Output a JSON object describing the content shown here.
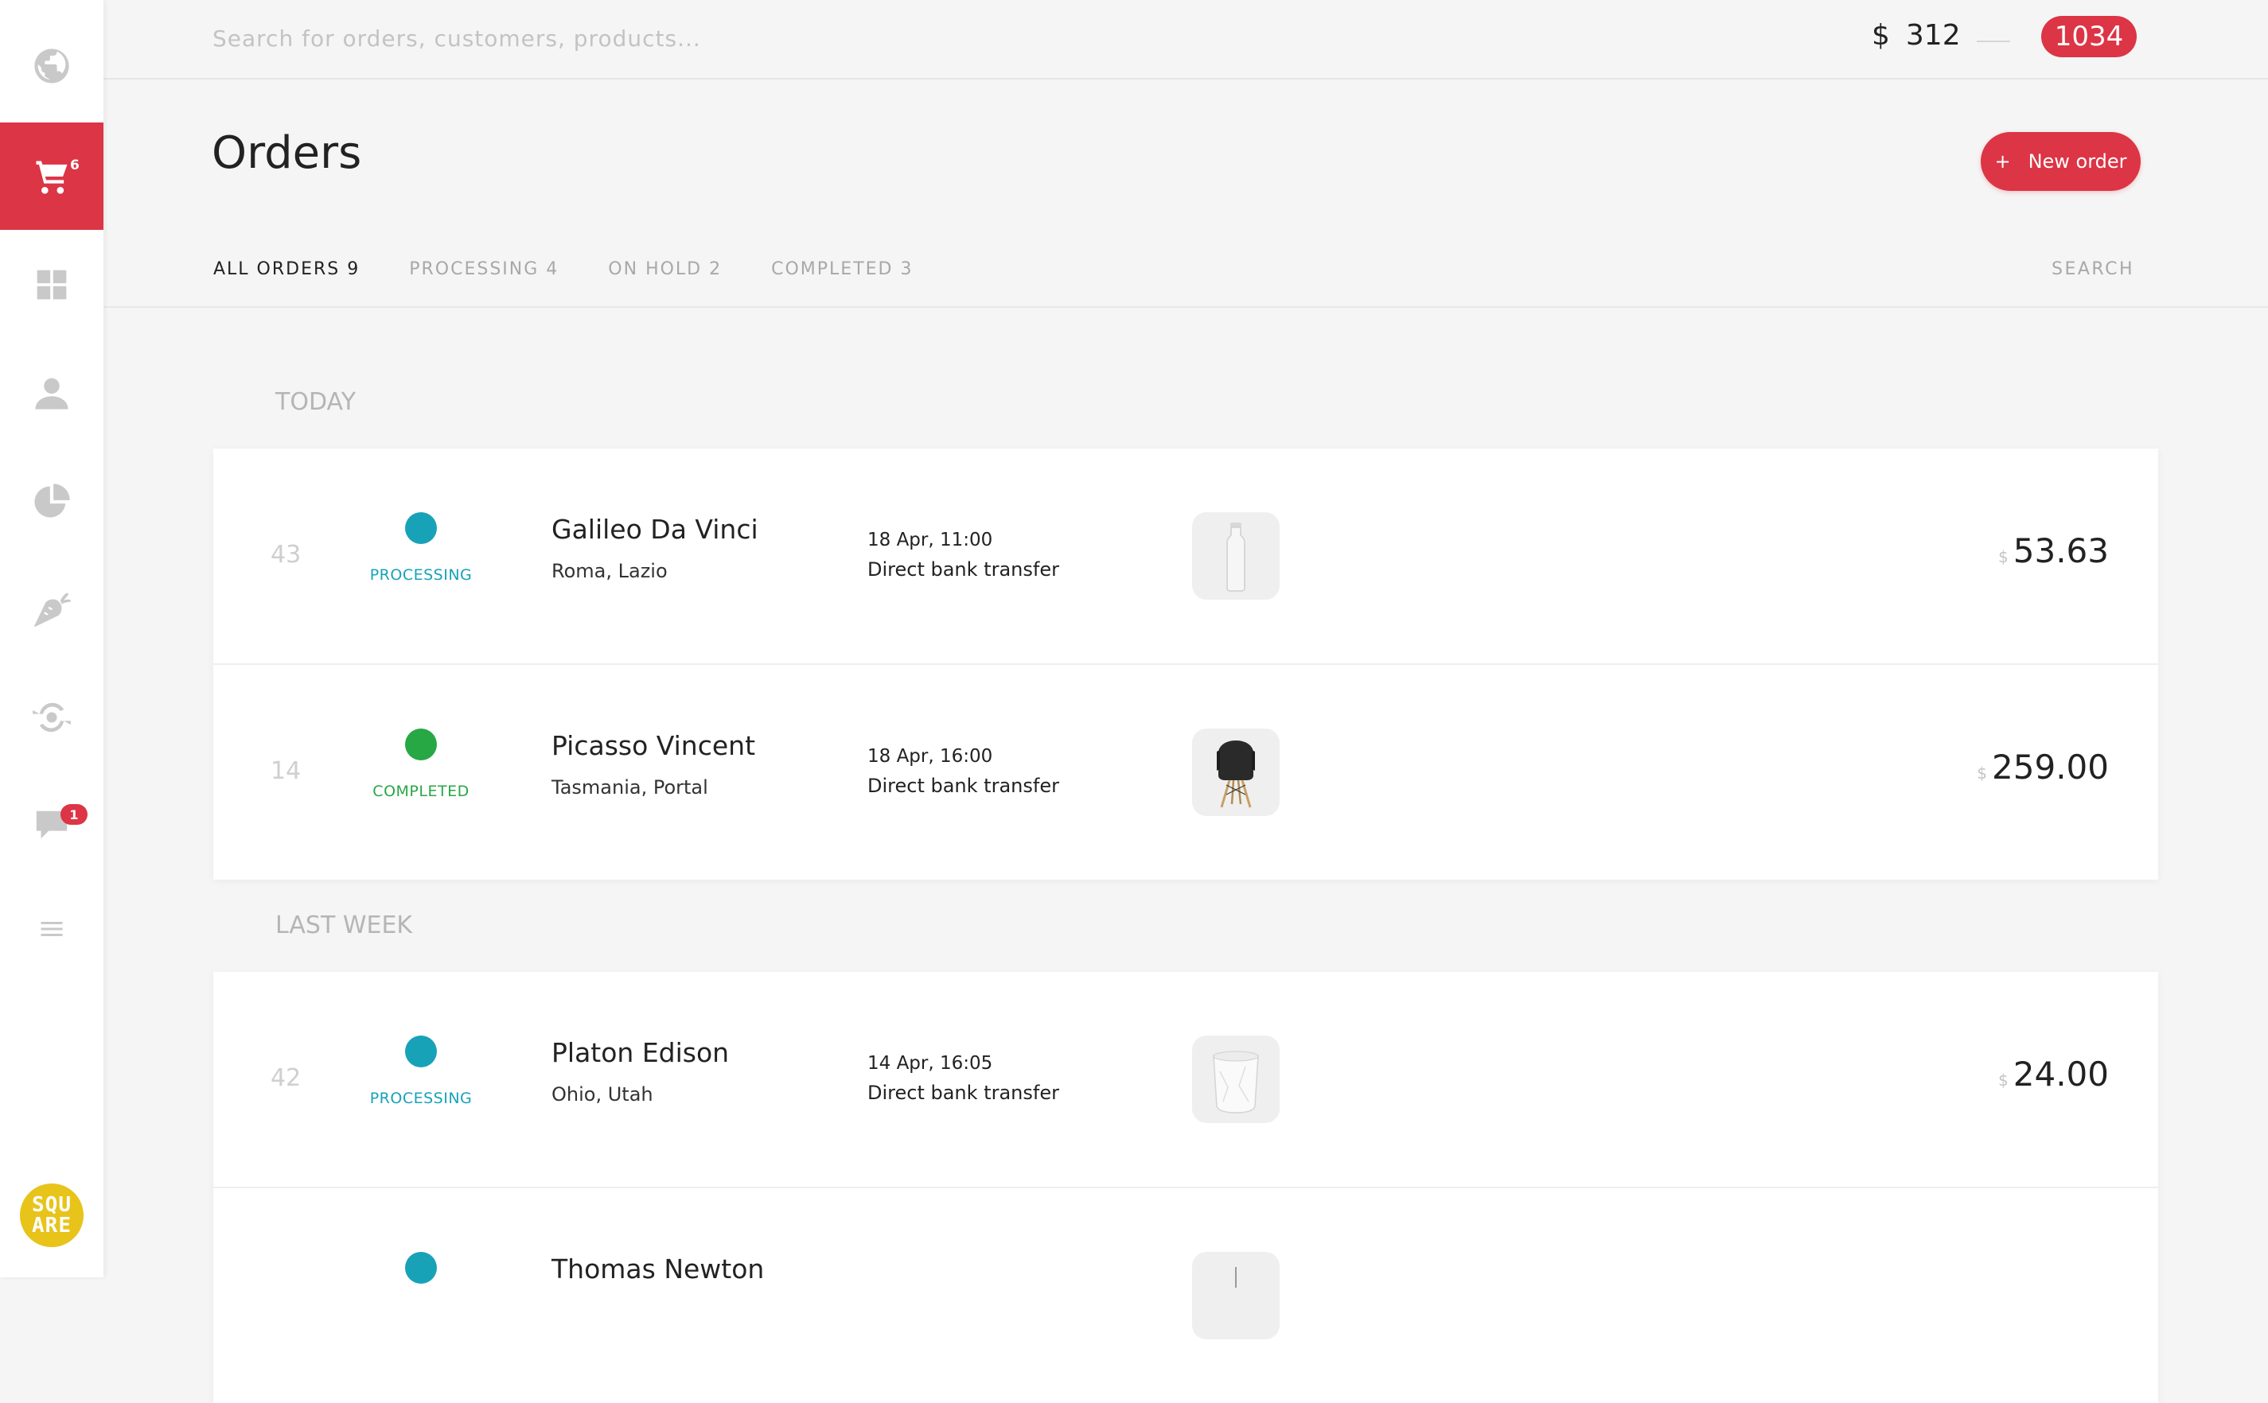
{
  "sidebar": {
    "items": [
      {
        "name": "globe",
        "icon": "globe-icon",
        "active": false
      },
      {
        "name": "orders",
        "icon": "cart-icon",
        "active": true,
        "badge": "6"
      },
      {
        "name": "dashboard",
        "icon": "grid-icon",
        "active": false
      },
      {
        "name": "customers",
        "icon": "user-icon",
        "active": false
      },
      {
        "name": "reports",
        "icon": "pie-chart-icon",
        "active": false
      },
      {
        "name": "products",
        "icon": "carrot-icon",
        "active": false
      },
      {
        "name": "view",
        "icon": "eye-sync-icon",
        "active": false
      },
      {
        "name": "messages",
        "icon": "chat-icon",
        "active": false,
        "badge": "1"
      },
      {
        "name": "menu",
        "icon": "menu-icon",
        "active": false
      }
    ],
    "logo": {
      "line1": "SQU",
      "line2": "ARE",
      "color": "#e8c31a"
    }
  },
  "header": {
    "search_placeholder": "Search for orders, customers, products...",
    "search_value": "",
    "balance_currency": "$",
    "balance_value": "312",
    "notification_count": "1034"
  },
  "page": {
    "title": "Orders",
    "new_order_icon": "+",
    "new_order_label": "New order"
  },
  "tabs": [
    {
      "label": "ALL ORDERS 9",
      "active": true
    },
    {
      "label": "PROCESSING 4",
      "active": false
    },
    {
      "label": "ON HOLD 2",
      "active": false
    },
    {
      "label": "COMPLETED 3",
      "active": false
    }
  ],
  "tab_search_label": "SEARCH",
  "colors": {
    "accent": "#dc3545",
    "processing": "#18a2b8",
    "completed": "#28a745"
  },
  "groups": [
    {
      "label": "TODAY",
      "orders": [
        {
          "number": "43",
          "status": "PROCESSING",
          "status_color": "#18a2b8",
          "customer": "Galileo Da Vinci",
          "location": "Roma, Lazio",
          "date": "18 Apr, 11:00",
          "payment": "Direct bank transfer",
          "product": "glass-bottle",
          "currency": "$",
          "amount": "53.63"
        },
        {
          "number": "14",
          "status": "COMPLETED",
          "status_color": "#28a745",
          "customer": "Picasso Vincent",
          "location": "Tasmania, Portal",
          "date": "18 Apr, 16:00",
          "payment": "Direct bank transfer",
          "product": "black-chair",
          "currency": "$",
          "amount": "259.00"
        }
      ]
    },
    {
      "label": "LAST WEEK",
      "orders": [
        {
          "number": "42",
          "status": "PROCESSING",
          "status_color": "#18a2b8",
          "customer": "Platon Edison",
          "location": "Ohio, Utah",
          "date": "14 Apr, 16:05",
          "payment": "Direct bank transfer",
          "product": "paper-bag",
          "currency": "$",
          "amount": "24.00"
        },
        {
          "number": "",
          "status": "",
          "status_color": "#18a2b8",
          "customer": "Thomas Newton",
          "location": "",
          "date": "",
          "payment": "",
          "product": "glass-bottle",
          "currency": "",
          "amount": ""
        }
      ]
    }
  ]
}
